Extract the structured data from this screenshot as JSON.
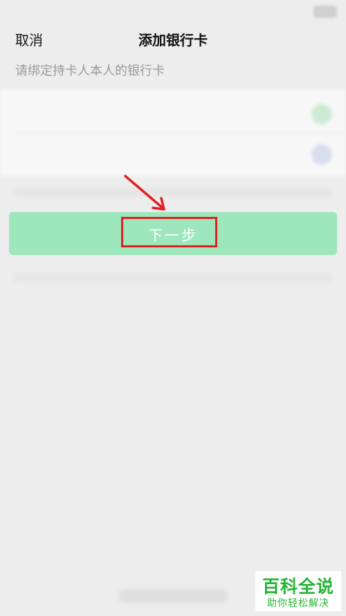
{
  "nav": {
    "cancel_label": "取消",
    "title": "添加银行卡"
  },
  "hint": "请绑定持卡人本人的银行卡",
  "next_button": {
    "label": "下一步"
  },
  "colors": {
    "button_bg": "#9ee6bb",
    "highlight": "#e02020",
    "watermark": "#25b532"
  },
  "watermark": {
    "main": "百科全说",
    "sub": "助你轻松解决"
  }
}
